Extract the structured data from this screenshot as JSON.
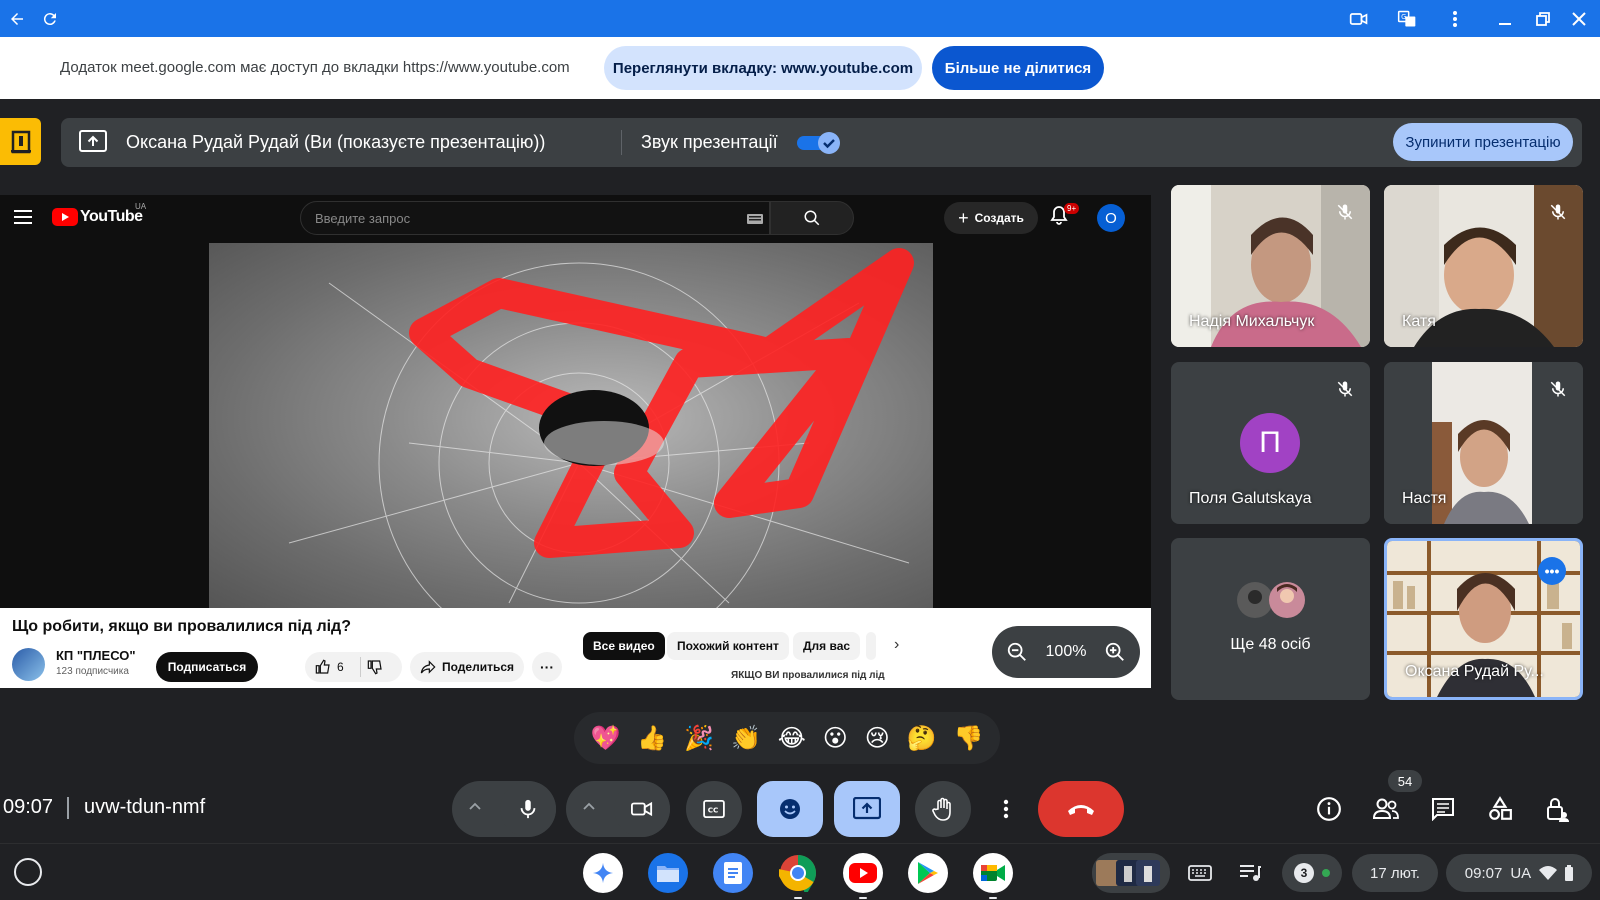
{
  "share_notice": {
    "text": "Додаток meet.google.com має доступ до вкладки https://www.youtube.com",
    "view_tab_label": "Переглянути вкладку: www.youtube.com",
    "stop_sharing_label": "Більше не ділитися"
  },
  "presentation": {
    "title": "Оксана Рудай Рудай (Ви (показуєте презентацію))",
    "sound_label": "Звук презентації",
    "sound_enabled": true,
    "stop_label": "Зупинити презентацію"
  },
  "youtube": {
    "logo_text": "YouTube",
    "region": "UA",
    "search_placeholder": "Введите запрос",
    "create_label": "Создать",
    "notifications_badge": "9+",
    "avatar_letter": "О",
    "video_title": "Що робити, якщо ви провалилися під лід?",
    "channel_name": "КП \"ПЛЕСО\"",
    "channel_subs": "123 подписчика",
    "subscribe_label": "Подписаться",
    "likes": "6",
    "share_label": "Поделиться",
    "more_label": "···",
    "chips": [
      "Все видео",
      "Похожий контент",
      "Для вас"
    ],
    "next_video_title": "ЯКЩО ВИ провалилися під лід"
  },
  "zoom": {
    "level": "100%"
  },
  "participants": [
    {
      "name": "Надія Михальчук",
      "muted": true
    },
    {
      "name": "Катя",
      "muted": true
    },
    {
      "name": "Поля Galutskaya",
      "initial": "П",
      "muted": true
    },
    {
      "name": "Настя",
      "muted": true
    },
    {
      "name": "Ще 48 осіб"
    },
    {
      "name": "Оксана Рудай Ру..."
    }
  ],
  "reactions": [
    "💖",
    "👍",
    "🎉",
    "👏",
    "😂",
    "😮",
    "😢",
    "🤔",
    "👎"
  ],
  "meeting": {
    "time": "09:07",
    "code": "uvw-tdun-nmf",
    "people_count": "54"
  },
  "shelf": {
    "notification_count": "3",
    "date": "17 лют.",
    "time": "09:07",
    "locale": "UA"
  },
  "colors": {
    "chrome_bar": "#1a73e8",
    "end_call": "#dc362e",
    "active_button": "#a8c7fa",
    "avatar_p": "#a142c4"
  }
}
